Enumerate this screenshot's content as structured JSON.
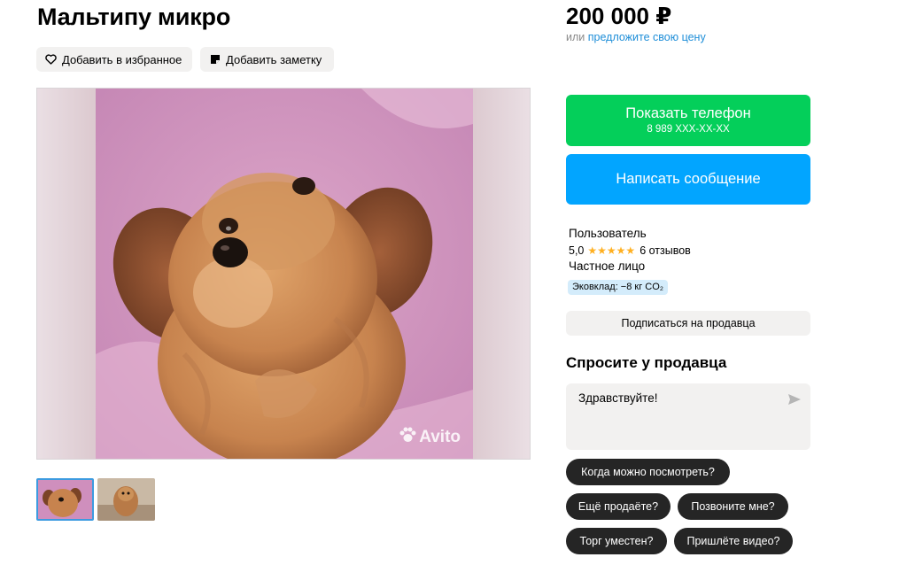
{
  "listing": {
    "title": "Мальтипу микро",
    "favorite_label": "Добавить в избранное",
    "note_label": "Добавить заметку",
    "watermark": "Avito"
  },
  "icons": {
    "favorite": "heart-icon",
    "note": "note-icon",
    "send": "send-arrow-icon",
    "watermark": "paw-icon"
  },
  "price": {
    "amount": "200 000 ₽",
    "offer_prefix": "или",
    "offer_link": "предложите свою цену"
  },
  "contact": {
    "phone_label": "Показать телефон",
    "phone_masked": "8 989 XXX-XX-XX",
    "message_label": "Написать сообщение"
  },
  "seller": {
    "name": "Пользователь",
    "rating": "5,0",
    "stars": "★★★★★",
    "reviews": "6 отзывов",
    "type": "Частное лицо",
    "eco": "Эковклад: −8 кг CO₂",
    "subscribe_label": "Подписаться на продавца"
  },
  "ask": {
    "title": "Спросите у продавца",
    "input_value": "Здравствуйте!",
    "quick_questions": [
      "Когда можно посмотреть?",
      "Ещё продаёте?",
      "Позвоните мне?",
      "Торг уместен?",
      "Пришлёте видео?"
    ]
  },
  "colors": {
    "green_button": "#04cf5a",
    "blue_button": "#02a5ff",
    "link": "#1e8ed8",
    "chip": "#252525",
    "star": "#ffb021"
  }
}
